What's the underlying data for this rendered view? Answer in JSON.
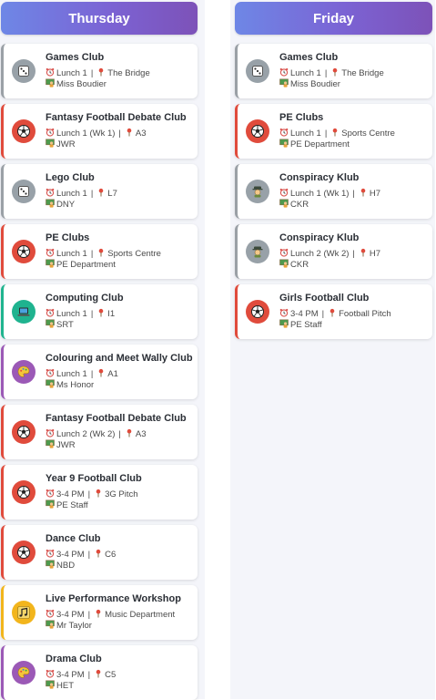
{
  "days": [
    {
      "name": "Thursday",
      "clubs": [
        {
          "title": "Games Club",
          "time": "Lunch 1",
          "location": "The Bridge",
          "staff": "Miss Boudier",
          "icon": "dice-icon",
          "color": "gray"
        },
        {
          "title": "Fantasy Football Debate Club",
          "time": "Lunch 1 (Wk 1)",
          "location": "A3",
          "staff": "JWR",
          "icon": "football-icon",
          "color": "red"
        },
        {
          "title": "Lego Club",
          "time": "Lunch 1",
          "location": "L7",
          "staff": "DNY",
          "icon": "dice-icon",
          "color": "gray"
        },
        {
          "title": "PE Clubs",
          "time": "Lunch 1",
          "location": "Sports Centre",
          "staff": "PE Department",
          "icon": "football-icon",
          "color": "red"
        },
        {
          "title": "Computing Club",
          "time": "Lunch 1",
          "location": "I1",
          "staff": "SRT",
          "icon": "laptop-icon",
          "color": "teal"
        },
        {
          "title": "Colouring and Meet Wally Club",
          "time": "Lunch 1",
          "location": "A1",
          "staff": "Ms Honor",
          "icon": "palette-icon",
          "color": "purple"
        },
        {
          "title": "Fantasy Football Debate Club",
          "time": "Lunch 2 (Wk 2)",
          "location": "A3",
          "staff": "JWR",
          "icon": "football-icon",
          "color": "red"
        },
        {
          "title": "Year 9 Football Club",
          "time": "3-4 PM",
          "location": "3G Pitch",
          "staff": "PE Staff",
          "icon": "football-icon",
          "color": "red"
        },
        {
          "title": "Dance Club",
          "time": "3-4 PM",
          "location": "C6",
          "staff": "NBD",
          "icon": "football-icon",
          "color": "red"
        },
        {
          "title": "Live Performance Workshop",
          "time": "3-4 PM",
          "location": "Music Department",
          "staff": "Mr Taylor",
          "icon": "music-note-icon",
          "color": "yellow"
        },
        {
          "title": "Drama Club",
          "time": "3-4 PM",
          "location": "C5",
          "staff": "HET",
          "icon": "palette-icon",
          "color": "purple"
        }
      ]
    },
    {
      "name": "Friday",
      "clubs": [
        {
          "title": "Games Club",
          "time": "Lunch 1",
          "location": "The Bridge",
          "staff": "Miss Boudier",
          "icon": "dice-icon",
          "color": "gray"
        },
        {
          "title": "PE Clubs",
          "time": "Lunch 1",
          "location": "Sports Centre",
          "staff": "PE Department",
          "icon": "football-icon",
          "color": "red"
        },
        {
          "title": "Conspiracy Klub",
          "time": "Lunch 1 (Wk 1)",
          "location": "H7",
          "staff": "CKR",
          "icon": "detective-icon",
          "color": "gray"
        },
        {
          "title": "Conspiracy Klub",
          "time": "Lunch 2 (Wk 2)",
          "location": "H7",
          "staff": "CKR",
          "icon": "detective-icon",
          "color": "gray"
        },
        {
          "title": "Girls Football Club",
          "time": "3-4 PM",
          "location": "Football Pitch",
          "staff": "PE Staff",
          "icon": "football-icon",
          "color": "red"
        }
      ]
    }
  ],
  "separator": "|",
  "meta_icons": {
    "time": "alarm-clock-icon",
    "location": "pin-icon",
    "staff": "teacher-icon"
  },
  "colors": {
    "header_gradient_start": "#6e87e6",
    "header_gradient_end": "#7d52b8",
    "gray": "#9aa0a6",
    "red": "#e04b3c",
    "teal": "#20b48f",
    "purple": "#9b59b6",
    "yellow": "#f2b51c"
  }
}
